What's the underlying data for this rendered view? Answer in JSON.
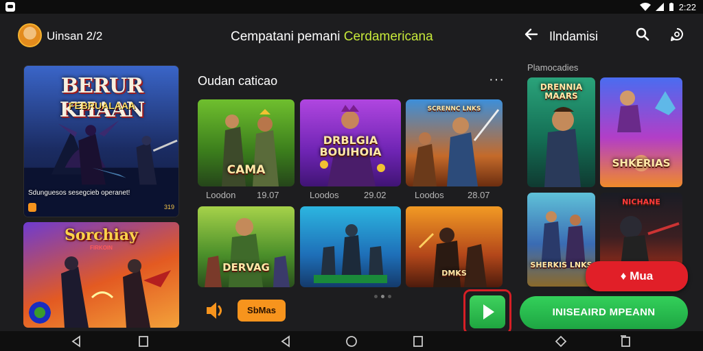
{
  "status_bar": {
    "time": "2:22"
  },
  "header": {
    "username": "Uinsan 2/2",
    "title_prefix": "Cempatani pemani ",
    "title_accent": "Cerdamericana",
    "right_title": "Ilndamisi"
  },
  "left_column": {
    "hero_card": {
      "title": "BERUR KHAAN",
      "subtitle": "FEBRUALAAA",
      "description": "Sdunguesos sesegcieb operanet!",
      "tag": "",
      "count": "319"
    },
    "second_card": {
      "title": "Sorchiay",
      "subtitle": "FIRKOIN"
    }
  },
  "main": {
    "section_title": "Oudan caticao",
    "more_label": "···",
    "games": [
      {
        "label": "CAMA",
        "meta_left": "Loodon",
        "meta_right": "19.07"
      },
      {
        "label": "DRBLGIA BOUIHOIA",
        "meta_left": "Loodos",
        "meta_right": "29.02"
      },
      {
        "label": "SCRENNC LNKS",
        "meta_left": "Loodos",
        "meta_right": "28.07"
      },
      {
        "label": "DERVAG",
        "meta_left": "",
        "meta_right": ""
      },
      {
        "label": "",
        "meta_left": "",
        "meta_right": ""
      },
      {
        "label": "DMKS",
        "meta_left": "",
        "meta_right": ""
      }
    ],
    "action_label": "SbMas"
  },
  "right_panel": {
    "section_label": "Plamocadies",
    "cards": [
      {
        "label": "DRENNIA MAARS"
      },
      {
        "label": "SHKERIAS"
      },
      {
        "label": "SHERKIS LNKS"
      },
      {
        "label": "NICHANE"
      }
    ],
    "more_label": "Mua",
    "install_label": "INISEAIRD MPEANN"
  },
  "colors": {
    "accent_green": "#c7e93a",
    "play_green": "#1fa640",
    "highlight_red": "#d71f25",
    "orange": "#f7941d"
  }
}
